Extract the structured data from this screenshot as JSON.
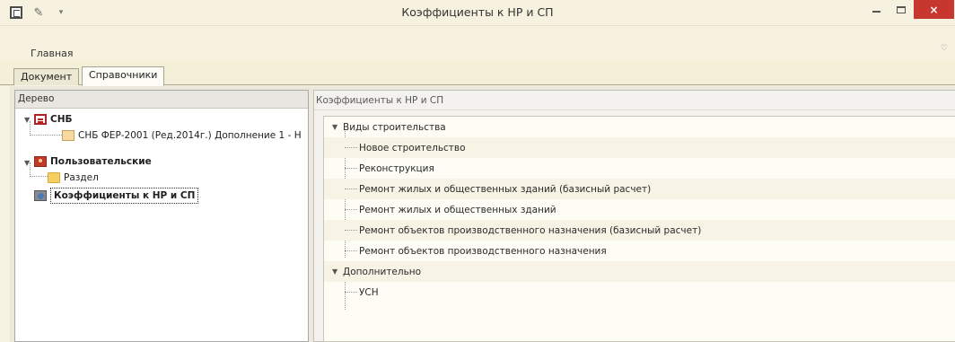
{
  "window": {
    "title": "Коэффициенты к НР и СП",
    "close_glyph": "×"
  },
  "ribbon": {
    "tab_label": "Главная"
  },
  "doc_tabs": [
    {
      "label": "Документ"
    },
    {
      "label": "Справочники"
    }
  ],
  "tree_panel": {
    "header": "Дерево",
    "nodes": [
      {
        "label": "СНБ",
        "icon": "snb-icon"
      },
      {
        "label": "СНБ ФЕР-2001 (Ред.2014г.) Дополнение 1 - Н",
        "icon": "book-icon"
      },
      {
        "label": "Пользовательские",
        "icon": "user-folder-icon"
      },
      {
        "label": "Раздел",
        "icon": "folder-icon"
      },
      {
        "label": "Коэффициенты к НР и СП",
        "icon": "coefficient-icon"
      }
    ]
  },
  "coef_panel": {
    "header": "Коэффициенты к НР и СП",
    "groups": [
      {
        "label": "Виды строительства",
        "items": [
          "Новое строительство",
          "Реконструкция",
          "Ремонт жилых и общественных зданий  (базисный расчет)",
          "Ремонт жилых и общественных зданий",
          "Ремонт объектов производственного назначения (базисный расчет)",
          "Ремонт объектов производственного назначения"
        ]
      },
      {
        "label": "Дополнительно",
        "items": [
          "УСН"
        ]
      }
    ]
  }
}
